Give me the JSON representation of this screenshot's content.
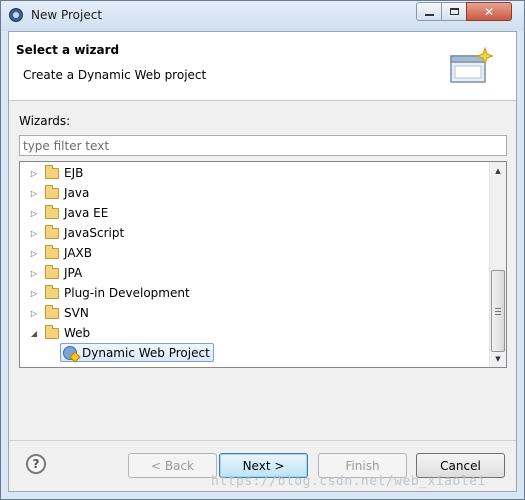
{
  "window": {
    "title": "New Project"
  },
  "header": {
    "title": "Select a wizard",
    "description": "Create a Dynamic Web project"
  },
  "wizards": {
    "label": "Wizards:",
    "filter_placeholder": "type filter text"
  },
  "tree": {
    "items": [
      {
        "label": "EJB",
        "expanded": false
      },
      {
        "label": "Java",
        "expanded": false
      },
      {
        "label": "Java EE",
        "expanded": false
      },
      {
        "label": "JavaScript",
        "expanded": false
      },
      {
        "label": "JAXB",
        "expanded": false
      },
      {
        "label": "JPA",
        "expanded": false
      },
      {
        "label": "Plug-in Development",
        "expanded": false
      },
      {
        "label": "SVN",
        "expanded": false
      },
      {
        "label": "Web",
        "expanded": true
      }
    ],
    "selected_child": "Dynamic Web Project"
  },
  "buttons": {
    "back": "< Back",
    "next": "Next >",
    "finish": "Finish",
    "cancel": "Cancel",
    "help": "?"
  },
  "watermark": "https://blog.csdn.net/web_xiaolei"
}
